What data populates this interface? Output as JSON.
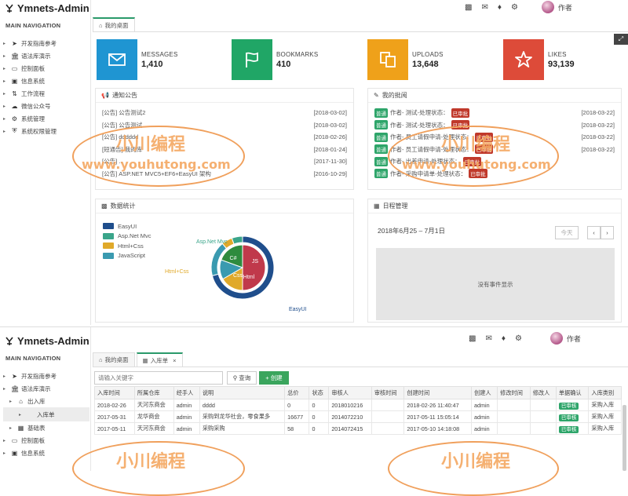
{
  "app_title": "Ymnets-Admin",
  "nav_header": "MAIN NAVIGATION",
  "colors": {
    "messages": "#1f95d2",
    "bookmarks": "#20a666",
    "uploads": "#efa11a",
    "likes": "#dd4b39",
    "green": "#2ea56a"
  },
  "top": {
    "sidebar_items": [
      {
        "label": "开发指南参考",
        "icon": "send-icon"
      },
      {
        "label": "语法库演示",
        "icon": "bank-icon"
      },
      {
        "label": "控制面板",
        "icon": "monitor-icon"
      },
      {
        "label": "信息系统",
        "icon": "box-icon"
      },
      {
        "label": "工作流程",
        "icon": "flow-icon"
      },
      {
        "label": "微信公众号",
        "icon": "wechat-icon"
      },
      {
        "label": "系统管理",
        "icon": "gears-icon"
      },
      {
        "label": "系统权限管理",
        "icon": "shield-icon"
      }
    ],
    "user_name": "作者",
    "tab_home": "我的桌面",
    "stats": [
      {
        "label": "MESSAGES",
        "value": "1,410",
        "icon": "envelope-icon"
      },
      {
        "label": "BOOKMARKS",
        "value": "410",
        "icon": "flag-icon"
      },
      {
        "label": "UPLOADS",
        "value": "13,648",
        "icon": "files-icon"
      },
      {
        "label": "LIKES",
        "value": "93,139",
        "icon": "star-icon"
      }
    ],
    "notices_title": "通知公告",
    "notices": [
      {
        "text": "[公告] 公告测试2",
        "date": "[2018-03-02]"
      },
      {
        "text": "[公告] 公告测试",
        "date": "[2018-03-02]"
      },
      {
        "text": "[公告] dddddd",
        "date": "[2018-02-26]"
      },
      {
        "text": "[短通告] 我的库",
        "date": "[2018-01-24]"
      },
      {
        "text": "[公告] ...",
        "date": "[2017-11-30]"
      },
      {
        "text": "[公告] ASP.NET MVC5+EF6+EasyUI 架构",
        "date": "[2016-10-29]"
      }
    ],
    "approvals_title": "我的批阅",
    "approvals": [
      {
        "tag": "普通",
        "text": "作者- 测试-处理状态：",
        "status": "已审批",
        "date": "[2018-03-22]"
      },
      {
        "tag": "普通",
        "text": "作者- 测试-处理状态：",
        "status": "已审批",
        "date": "[2018-03-22]"
      },
      {
        "tag": "普通",
        "text": "作者- 员工请假申请-处理状态：",
        "status": "已审批",
        "date": "[2018-03-22]"
      },
      {
        "tag": "普通",
        "text": "作者- 员工请假申请-处理状态：",
        "status": "已审批",
        "date": "[2018-03-22]"
      },
      {
        "tag": "普通",
        "text": "作者- 出差申请-处理状态：",
        "status": "已审批",
        "date": ""
      },
      {
        "tag": "普通",
        "text": "作者- 采购申请单-处理状态：",
        "status": "已审批",
        "date": ""
      }
    ],
    "stats_title": "数据统计",
    "calendar_title": "日程管理",
    "calendar_range": "2018年6月25 – 7月1日",
    "today_label": "今天",
    "no_events": "没有事件显示"
  },
  "chart_data": {
    "type": "pie",
    "legend": [
      "EasyUI",
      "Asp.Net Mvc",
      "Html+Css",
      "JavaScript"
    ],
    "outer_labels": [
      "Asp.Net Mvc",
      "Html+Css",
      "EasyUI",
      "JavaScript"
    ],
    "inner_labels": [
      "C#",
      "JS",
      "Css",
      "Html"
    ],
    "colors": [
      "#1f4e8c",
      "#3aa58a",
      "#e0a92a",
      "#3a9ab0"
    ]
  },
  "bottom": {
    "sidebar_items": [
      {
        "label": "开发指南参考",
        "icon": "send-icon"
      },
      {
        "label": "语法库演示",
        "icon": "bank-icon"
      },
      {
        "label": "出入库",
        "icon": "home-icon"
      },
      {
        "label": "入库单",
        "icon": ""
      },
      {
        "label": "基础表",
        "icon": "table-icon"
      },
      {
        "label": "控制面板",
        "icon": "monitor-icon"
      },
      {
        "label": "信息系统",
        "icon": "box-icon"
      }
    ],
    "tabs": [
      "我的桌面",
      "入库单"
    ],
    "search_placeholder": "请输入关键字",
    "query_label": "查询",
    "create_label": "创建",
    "columns": [
      "入库时间",
      "所属仓库",
      "经手人",
      "说明",
      "总价",
      "状态",
      "审核人",
      "审核时间",
      "创建时间",
      "创建人",
      "修改时间",
      "修改人",
      "单据确认",
      "入库类别"
    ],
    "rows": [
      [
        "2018-02-26",
        "天河东商会",
        "admin",
        "dddd",
        "0",
        "0",
        "2018010216",
        "",
        "2018-02-26 11:40:47",
        "admin",
        "",
        "",
        "已审核",
        "采购入库"
      ],
      [
        "2017-05-31",
        "龙华商会",
        "admin",
        "采购到龙华社会，零食果多",
        "16677",
        "0",
        "2014072210",
        "",
        "2017-05-11 15:05:14",
        "admin",
        "",
        "",
        "已审核",
        "采购入库"
      ],
      [
        "2017-05-11",
        "天河东商会",
        "admin",
        "采购采购",
        "58",
        "0",
        "2014072415",
        "",
        "2017-05-10 14:18:08",
        "admin",
        "",
        "",
        "已审核",
        "采购入库"
      ]
    ]
  },
  "watermark": {
    "title": "小川编程",
    "url": "www.youhutong.com"
  }
}
